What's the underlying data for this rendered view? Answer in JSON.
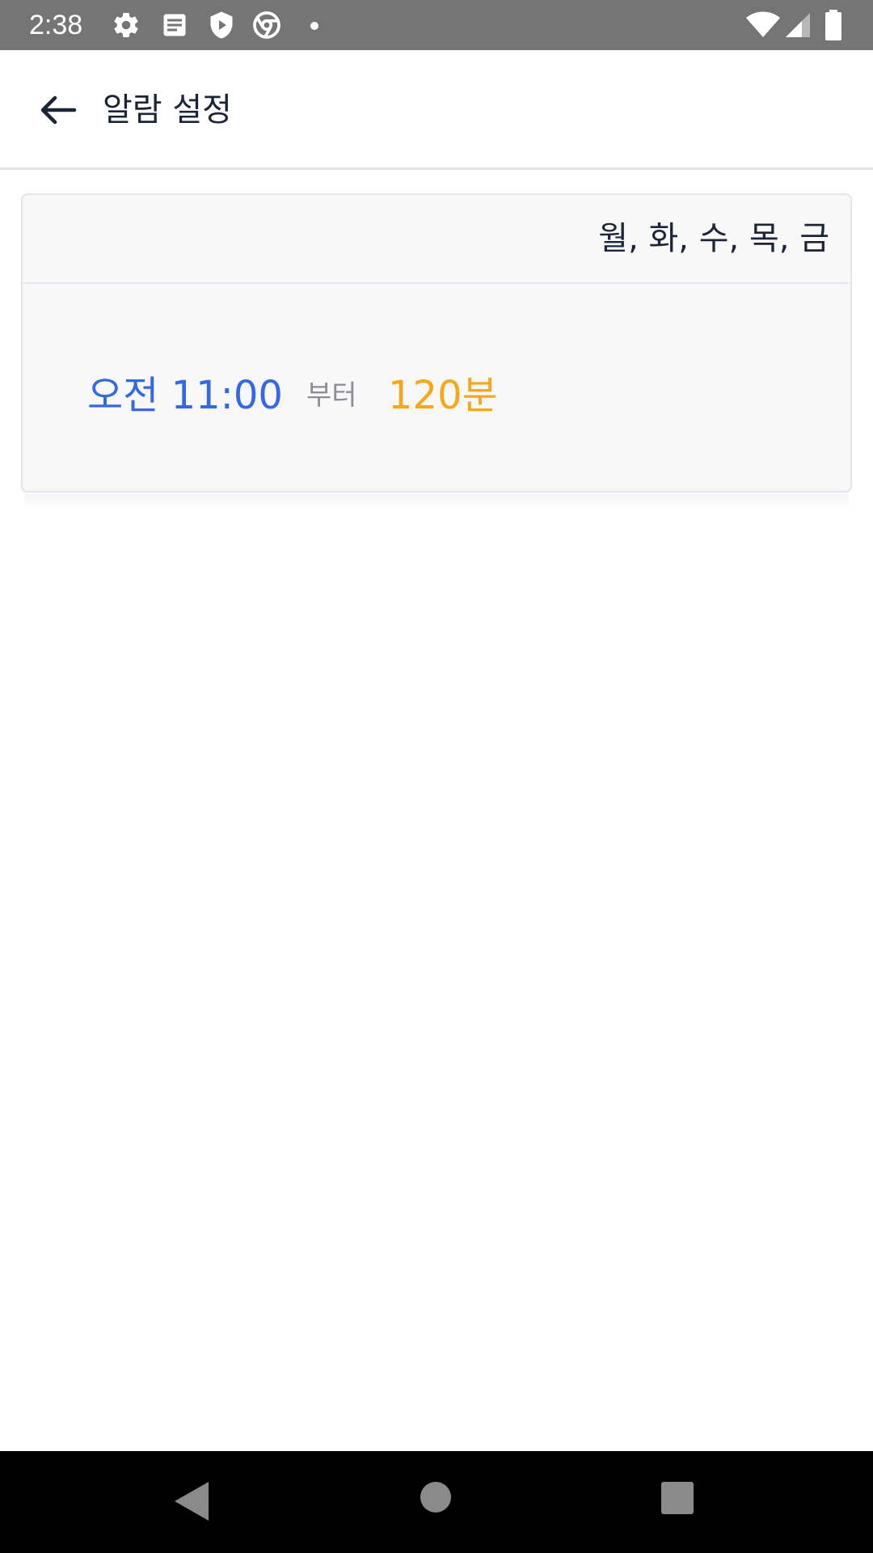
{
  "status_bar": {
    "time": "2:38",
    "icons": [
      "settings-icon",
      "notes-icon",
      "shield-play-icon",
      "chrome-icon",
      "dot-icon",
      "wifi-icon",
      "signal-icon",
      "battery-icon"
    ]
  },
  "app_bar": {
    "back_icon": "arrow-back-icon",
    "title": "알람 설정"
  },
  "alarm": {
    "days": "월, 화, 수, 목, 금",
    "time": "오전 11:00",
    "from_label": "부터",
    "duration": "120분"
  },
  "nav_bar": {
    "icons": [
      "back-triangle-icon",
      "home-circle-icon",
      "recents-square-icon"
    ]
  },
  "colors": {
    "status_bar": "#757575",
    "primary_text": "#1c2437",
    "time_blue": "#3468e4",
    "duration_orange": "#f6a81a",
    "muted_gray": "#8c8f99",
    "card_bg": "#f8f8f9",
    "nav_bar": "#000000"
  }
}
